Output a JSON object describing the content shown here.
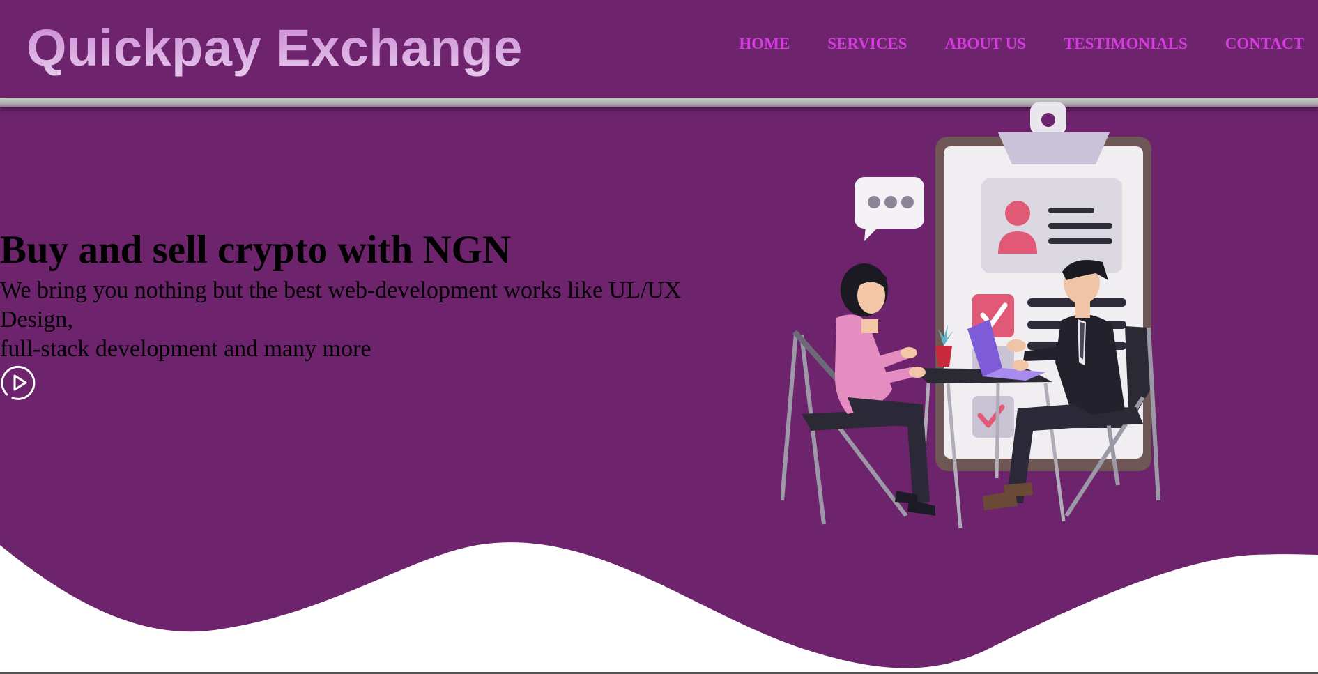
{
  "header": {
    "logo_text": "Quickpay Exchange",
    "nav": [
      "HOME",
      "SERVICES",
      "ABOUT US",
      "TESTIMONIALS",
      "CONTACT"
    ]
  },
  "hero": {
    "title": "Buy and sell crypto with NGN",
    "subtitle_line1": "We bring you nothing but the best web-development works like UL/UX Design,",
    "subtitle_line2": "full-stack development and many more",
    "play_icon": "play-circle-icon"
  },
  "colors": {
    "background": "#6d246c",
    "nav_link": "#d63be0",
    "wave": "#ffffff"
  }
}
